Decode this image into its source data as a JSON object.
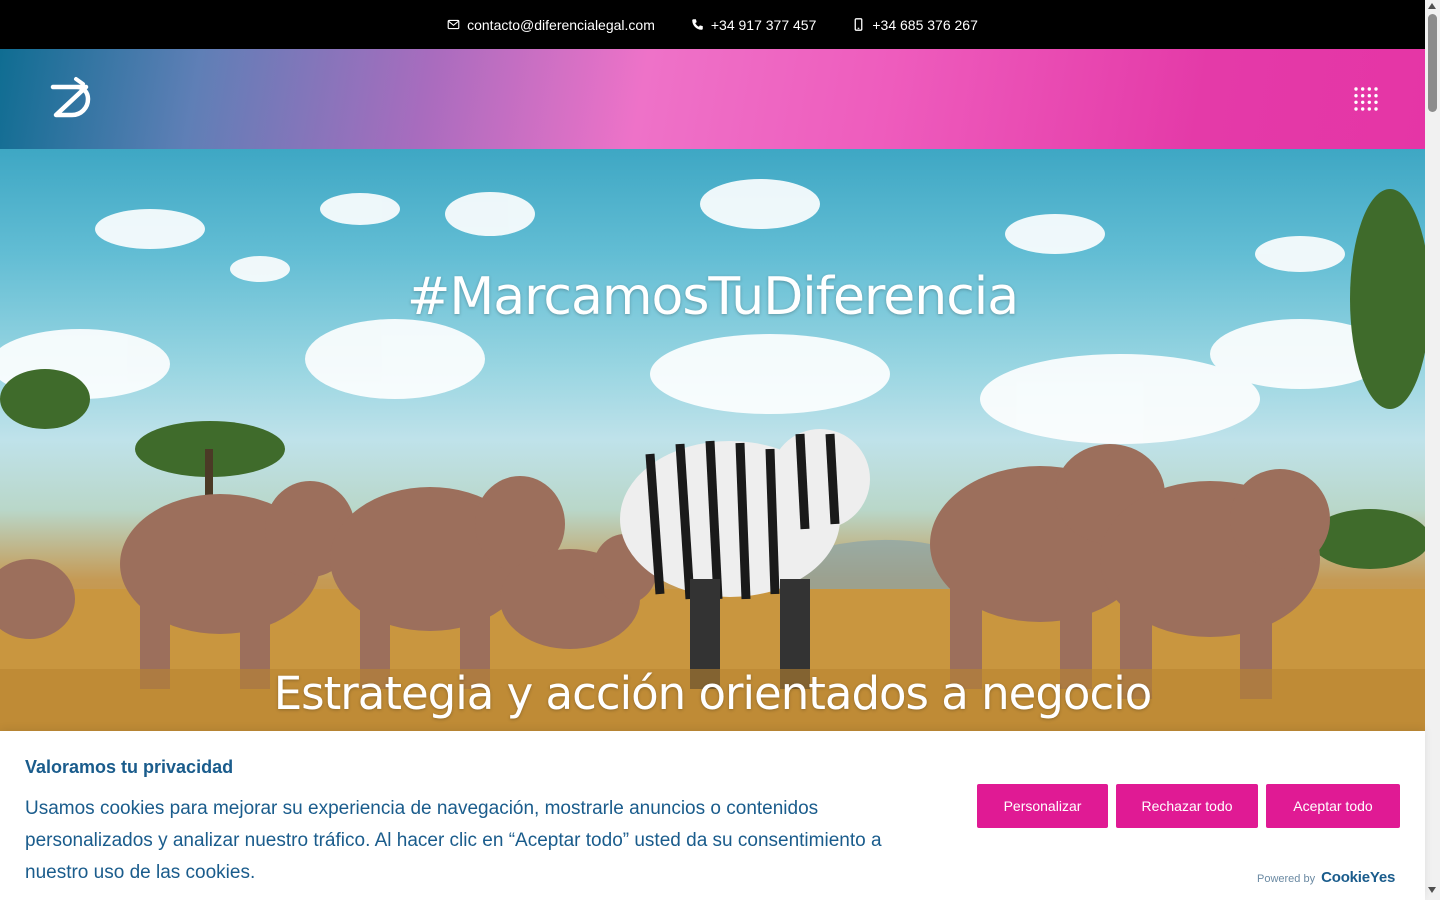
{
  "topbar": {
    "email": "contacto@diferencialegal.com",
    "phone": "+34 917 377 457",
    "mobile": "+34 685 376 267"
  },
  "header": {
    "logo_icon": "dl-logo-icon",
    "menu_icon": "grid-menu-icon"
  },
  "hero": {
    "title": "#MarcamosTuDiferencia",
    "subtitle": "Estrategia y acción orientados a negocio"
  },
  "cookie_banner": {
    "title": "Valoramos tu privacidad",
    "text": "Usamos cookies para mejorar su experiencia de navegación, mostrarle anuncios o contenidos personalizados y analizar nuestro tráfico. Al hacer clic en “Aceptar todo” usted da su consentimiento a nuestro uso de las cookies.",
    "buttons": {
      "customize": "Personalizar",
      "reject": "Rechazar todo",
      "accept": "Aceptar todo"
    },
    "powered_by": "Powered by",
    "brand": "CookieYes"
  },
  "colors": {
    "accent": "#e01a94",
    "text_blue": "#1a5c8c",
    "topbar_bg": "#000000"
  }
}
